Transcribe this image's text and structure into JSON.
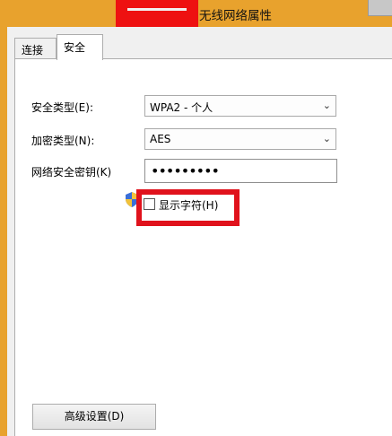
{
  "window": {
    "title": "无线网络属性"
  },
  "tabs": [
    {
      "label": "连接",
      "active": false
    },
    {
      "label": "安全",
      "active": true
    }
  ],
  "security": {
    "type_label": "安全类型(E):",
    "type_value": "WPA2 - 个人",
    "encryption_label": "加密类型(N):",
    "encryption_value": "AES",
    "key_label": "网络安全密钥(K)",
    "key_value": "•••••••••",
    "show_chars_label": "显示字符(H)",
    "show_chars_checked": false
  },
  "advanced_button_label": "高级设置(D)",
  "icons": {
    "shield": "uac-shield-icon",
    "dropdown": "chevron-down-icon"
  },
  "colors": {
    "title_bar": "#e8a22d",
    "highlight_box": "#e0121c",
    "redaction": "#ee1111"
  }
}
